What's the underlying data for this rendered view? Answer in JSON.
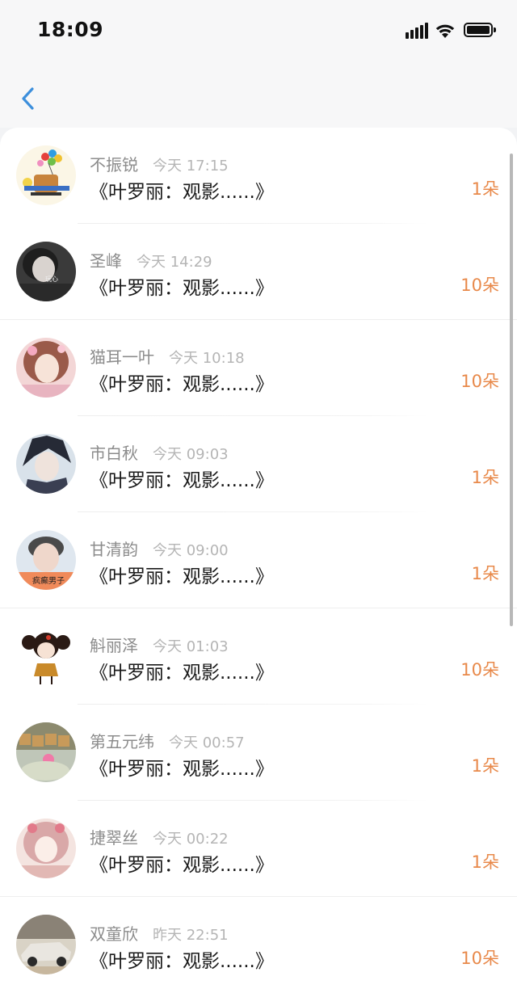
{
  "status_bar": {
    "time": "18:09"
  },
  "nav": {
    "back_icon": "chevron-left-icon"
  },
  "colors": {
    "accent": "#3d8fdc",
    "amount": "#e8894a",
    "name": "#8c8c8c",
    "time": "#b5b5b5"
  },
  "gifts": [
    {
      "name": "不振锐",
      "time": "今天 17:15",
      "title": "《叶罗丽：观影......》",
      "amount": "1朵"
    },
    {
      "name": "圣峰",
      "time": "今天 14:29",
      "title": "《叶罗丽：观影......》",
      "amount": "10朵"
    },
    {
      "name": "猫耳一叶",
      "time": "今天 10:18",
      "title": "《叶罗丽：观影......》",
      "amount": "10朵"
    },
    {
      "name": "市白秋",
      "time": "今天 09:03",
      "title": "《叶罗丽：观影......》",
      "amount": "1朵"
    },
    {
      "name": "甘清韵",
      "time": "今天 09:00",
      "title": "《叶罗丽：观影......》",
      "amount": "1朵"
    },
    {
      "name": "斛丽泽",
      "time": "今天 01:03",
      "title": "《叶罗丽：观影......》",
      "amount": "10朵"
    },
    {
      "name": "第五元纬",
      "time": "今天 00:57",
      "title": "《叶罗丽：观影......》",
      "amount": "1朵"
    },
    {
      "name": "捷翠丝",
      "time": "今天 00:22",
      "title": "《叶罗丽：观影......》",
      "amount": "1朵"
    },
    {
      "name": "双童欣",
      "time": "昨天 22:51",
      "title": "《叶罗丽：观影......》",
      "amount": "10朵"
    }
  ],
  "avatar_texts": {
    "row2": "玩心",
    "row5": "疯癫男子"
  }
}
